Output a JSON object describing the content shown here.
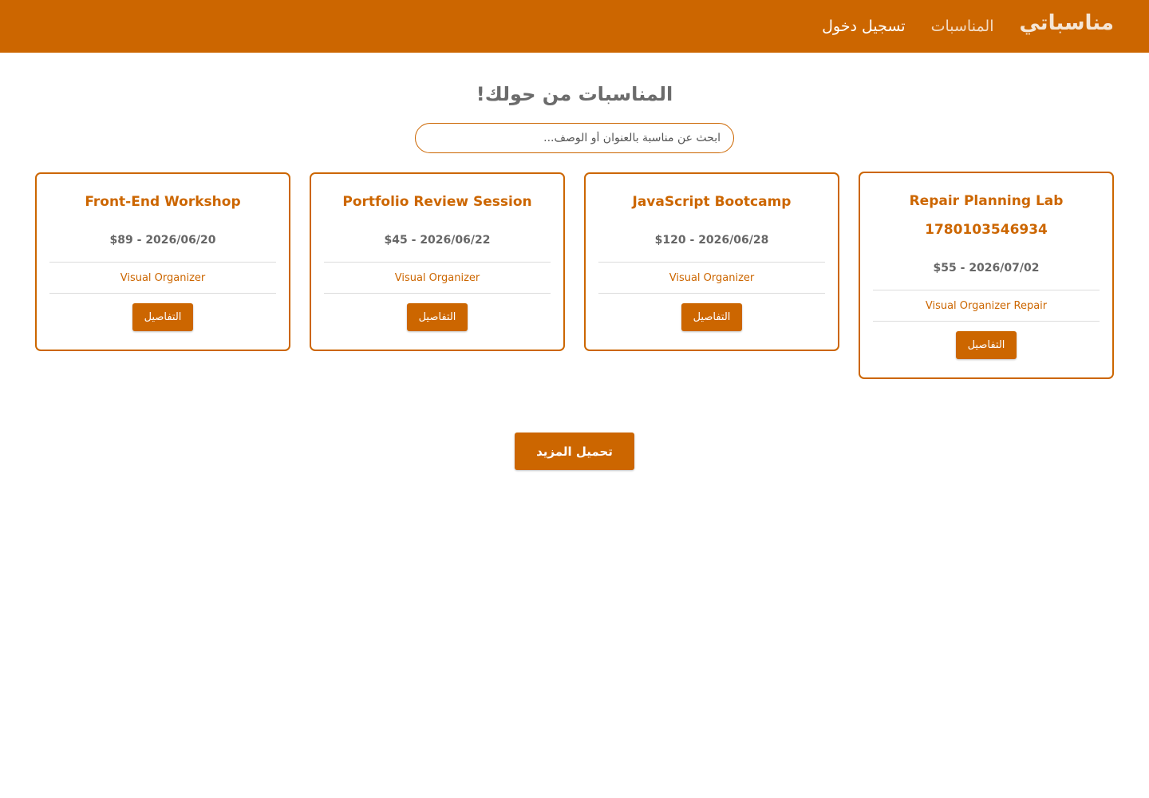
{
  "navbar": {
    "brand": "مناسباتي",
    "links": [
      "المناسبات",
      "تسجيل دخول"
    ]
  },
  "main": {
    "title": "المناسبات من حولك!",
    "search_placeholder": "ابحث عن مناسبة بالعنوان أو الوصف..."
  },
  "events": [
    {
      "title": "Repair Planning Lab",
      "subtitle": "1780103546934",
      "meta": "2026/07/02 - $55",
      "organizer": "Visual Organizer Repair",
      "button": "التفاصيل"
    },
    {
      "title": "JavaScript Bootcamp",
      "meta": "2026/06/28 - $120",
      "organizer": "Visual Organizer",
      "button": "التفاصيل"
    },
    {
      "title": "Portfolio Review Session",
      "meta": "2026/06/22 - $45",
      "organizer": "Visual Organizer",
      "button": "التفاصيل"
    },
    {
      "title": "Front-End Workshop",
      "meta": "2026/06/20 - $89",
      "organizer": "Visual Organizer",
      "button": "التفاصيل"
    }
  ],
  "load_more": "تحميل المزيد",
  "colors": {
    "accent": "#cc6600",
    "heading_text": "#6b6b6b"
  }
}
